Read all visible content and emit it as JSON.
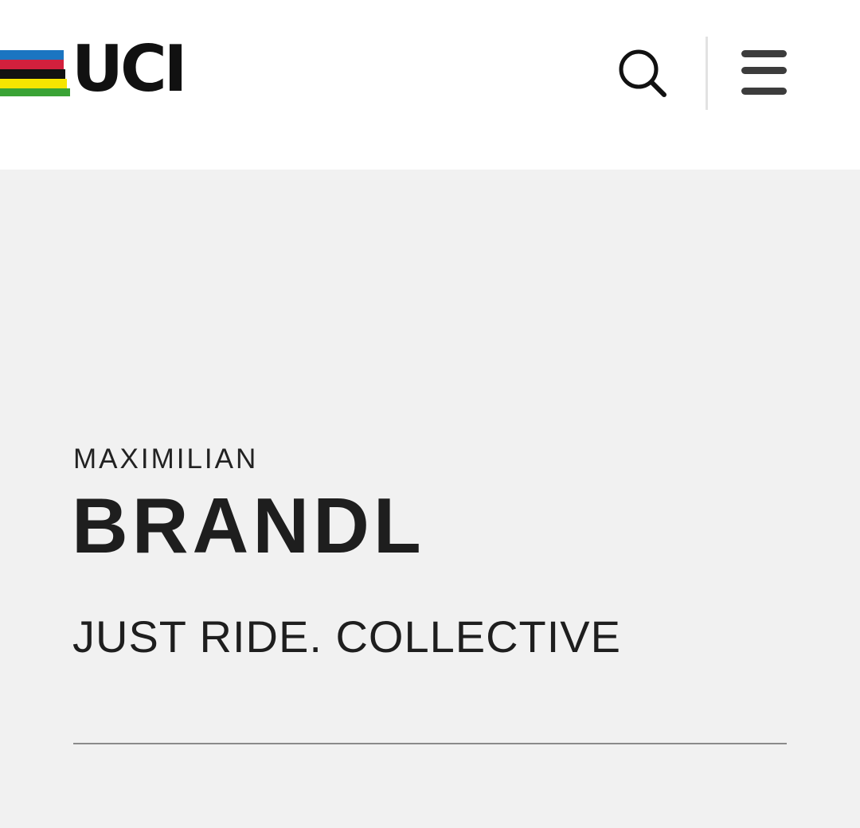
{
  "header": {
    "logo_text": "UCI",
    "search_icon": "search-icon",
    "menu_icon": "hamburger-menu-icon"
  },
  "rider": {
    "first_name": "MAXIMILIAN",
    "last_name": "BRANDL",
    "team": "JUST RIDE. COLLECTIVE"
  },
  "colors": {
    "header_bg": "#ffffff",
    "page_bg": "#f1f1f1",
    "text": "#1e1e1e",
    "stripe_blue": "#1b75c1",
    "stripe_red": "#d3203d",
    "stripe_black": "#111111",
    "stripe_yellow": "#f6e500",
    "stripe_green": "#3aa335"
  }
}
